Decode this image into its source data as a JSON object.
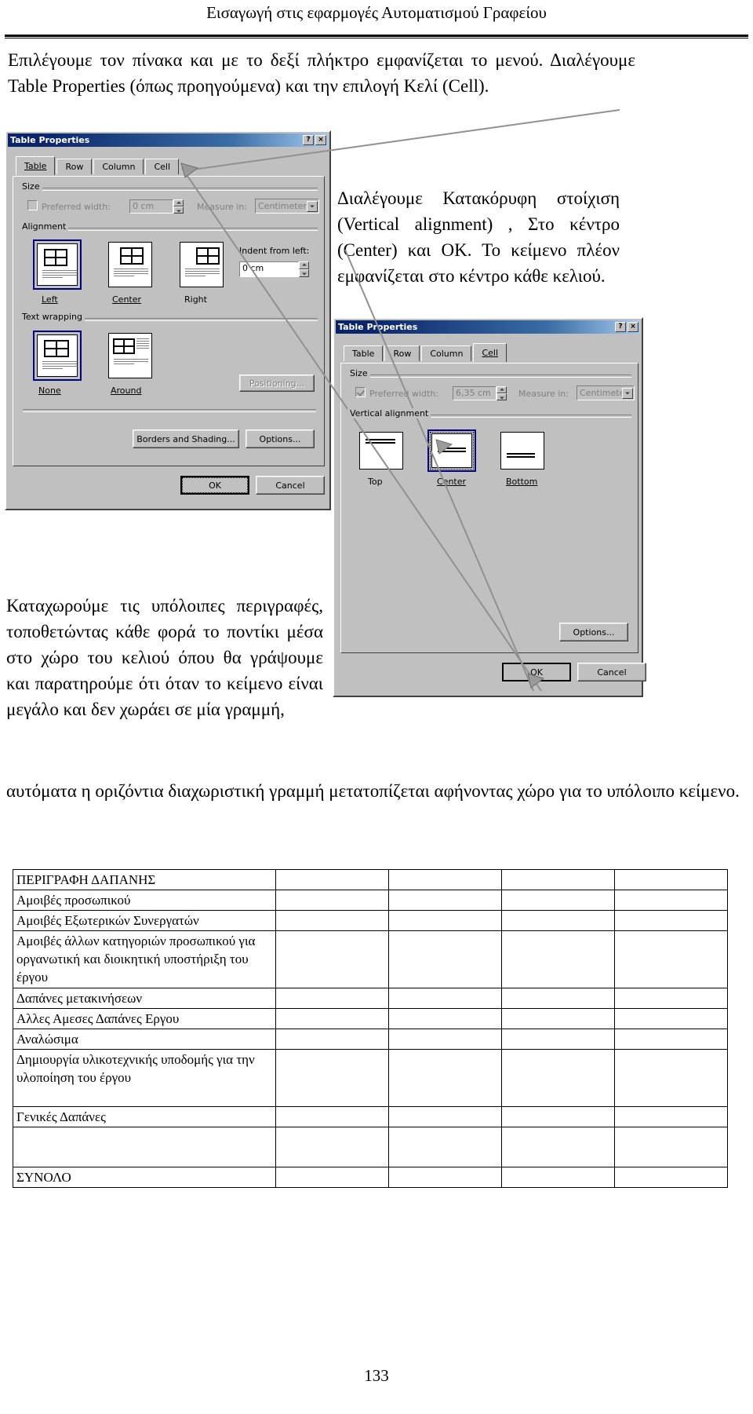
{
  "header": {
    "running_title": "Εισαγωγή στις εφαρμογές Αυτοματισμού Γραφείου"
  },
  "page_number": "133",
  "paragraphs": {
    "intro": "Επιλέγουμε τον πίνακα και με το δεξί πλήκτρο εμφανίζεται το μενού. Διαλέγουμε Table Properties (όπως προηγούμενα) και την επιλογή Κελί (Cell).",
    "vertical": "Διαλέγουμε Κατακόρυφη στοίχιση (Vertical alignment) , Στο κέντρο (Center) και ΟΚ. Το κείμενο πλέον εμφανίζεται στο κέντρο κάθε κελιού.",
    "fill": "Καταχωρούμε τις υπόλοιπες περιγραφές, τοποθετώντας κάθε φορά το ποντίκι μέσα στο χώρο του κελιού όπου θα γράψουμε και παρατηρούμε ότι όταν το κείμενο είναι μεγάλο και δεν χωράει σε μία γραμμή,",
    "wrap": "αυτόματα η οριζόντια διαχωριστική γραμμή μετατοπίζεται αφήνοντας χώρο για το υπόλοιπο κείμενο."
  },
  "dialog_table": {
    "title": "Table Properties",
    "help_button": "?",
    "close_button": "×",
    "tabs": [
      {
        "label": "Table",
        "accel": "T",
        "active": true
      },
      {
        "label": "Row",
        "accel": "R",
        "active": false
      },
      {
        "label": "Column",
        "accel": "u",
        "active": false
      },
      {
        "label": "Cell",
        "accel": "e",
        "active": false
      }
    ],
    "size_group": "Size",
    "preferred_width_label": "Preferred width:",
    "preferred_width_value": "0 cm",
    "preferred_width_checked": false,
    "measure_in_label": "Measure in:",
    "measure_in_value": "Centimeter",
    "alignment_group": "Alignment",
    "alignment_options": [
      {
        "label": "Left",
        "accel": "L",
        "selected": true
      },
      {
        "label": "Center",
        "accel": "C",
        "selected": false
      },
      {
        "label": "Right",
        "accel": "h",
        "selected": false
      }
    ],
    "indent_label": "Indent from left:",
    "indent_value": "0 cm",
    "text_wrapping_group": "Text wrapping",
    "wrapping_options": [
      {
        "label": "None",
        "accel": "N",
        "selected": true
      },
      {
        "label": "Around",
        "accel": "A",
        "selected": false
      }
    ],
    "positioning_button": "Positioning...",
    "borders_button": "Borders and Shading...",
    "options_button": "Options...",
    "ok_button": "OK",
    "cancel_button": "Cancel"
  },
  "dialog_cell": {
    "title": "Table Properties",
    "help_button": "?",
    "close_button": "×",
    "tabs": [
      {
        "label": "Table",
        "accel": "T",
        "active": false
      },
      {
        "label": "Row",
        "accel": "R",
        "active": false
      },
      {
        "label": "Column",
        "accel": "u",
        "active": false
      },
      {
        "label": "Cell",
        "accel": "e",
        "active": true
      }
    ],
    "size_group": "Size",
    "preferred_width_label": "Preferred width:",
    "preferred_width_value": "6,35 cm",
    "preferred_width_checked": true,
    "measure_in_label": "Measure in:",
    "measure_in_value": "Centimeter",
    "vertical_alignment_group": "Vertical alignment",
    "vertical_options": [
      {
        "label": "Top",
        "accel": "p",
        "selected": false
      },
      {
        "label": "Center",
        "accel": "C",
        "selected": true
      },
      {
        "label": "Bottom",
        "accel": "B",
        "selected": false
      }
    ],
    "options_button": "Options...",
    "ok_button": "OK",
    "cancel_button": "Cancel"
  },
  "expense_table": {
    "rows": [
      {
        "cells": [
          "ΠΕΡΙΓΡΑΦΗ ΔΑΠΑΝΗΣ",
          "",
          "",
          "",
          ""
        ],
        "height": "normal"
      },
      {
        "cells": [
          "Αμοιβές προσωπικού",
          "",
          "",
          "",
          ""
        ],
        "height": "normal"
      },
      {
        "cells": [
          "Αμοιβές Εξωτερικών Συνεργατών",
          "",
          "",
          "",
          ""
        ],
        "height": "normal"
      },
      {
        "cells": [
          "Αμοιβές άλλων κατηγοριών προσωπικού για οργανωτική και διοικητική υποστήριξη του έργου",
          "",
          "",
          "",
          ""
        ],
        "height": "xtall"
      },
      {
        "cells": [
          "Δαπάνες μετακινήσεων",
          "",
          "",
          "",
          ""
        ],
        "height": "normal"
      },
      {
        "cells": [
          "Αλλες Αμεσες Δαπάνες Εργου",
          "",
          "",
          "",
          ""
        ],
        "height": "normal"
      },
      {
        "cells": [
          "Αναλώσιμα",
          "",
          "",
          "",
          ""
        ],
        "height": "normal"
      },
      {
        "cells": [
          "Δημιουργία υλικοτεχνικής υποδομής για την υλοποίηση του έργου",
          "",
          "",
          "",
          ""
        ],
        "height": "xtall"
      },
      {
        "cells": [
          "Γενικές Δαπάνες",
          "",
          "",
          "",
          ""
        ],
        "height": "normal"
      },
      {
        "cells": [
          "",
          "",
          "",
          "",
          ""
        ],
        "height": "blank"
      },
      {
        "cells": [
          "ΣΥΝΟΛΟ",
          "",
          "",
          "",
          ""
        ],
        "height": "normal"
      }
    ]
  }
}
